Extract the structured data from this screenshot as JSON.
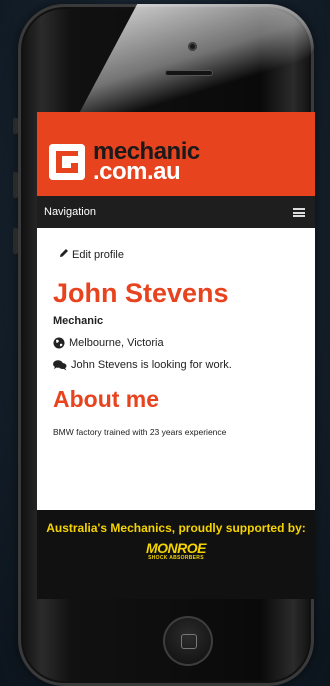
{
  "brand": {
    "name_line1": "mechanic",
    "name_line2": ".com.au"
  },
  "nav": {
    "label": "Navigation",
    "menu_icon": "hamburger-menu-icon"
  },
  "profile": {
    "edit_label": "Edit profile",
    "edit_icon": "pencil-icon",
    "name": "John Stevens",
    "role": "Mechanic",
    "location": "Melbourne, Victoria",
    "location_icon": "globe-icon",
    "status": "John Stevens is looking for work.",
    "status_icon": "chat-bubbles-icon"
  },
  "about": {
    "heading": "About me",
    "text": "BMW factory trained with 23 years experience"
  },
  "footer": {
    "text": "Australia's Mechanics, proudly supported by:",
    "sponsor": "MONROE",
    "sponsor_sub": "SHOCK ABSORBERS"
  },
  "colors": {
    "brand": "#e8431f",
    "nav_bg": "#1e1e1e",
    "footer_accent": "#f5d400"
  }
}
